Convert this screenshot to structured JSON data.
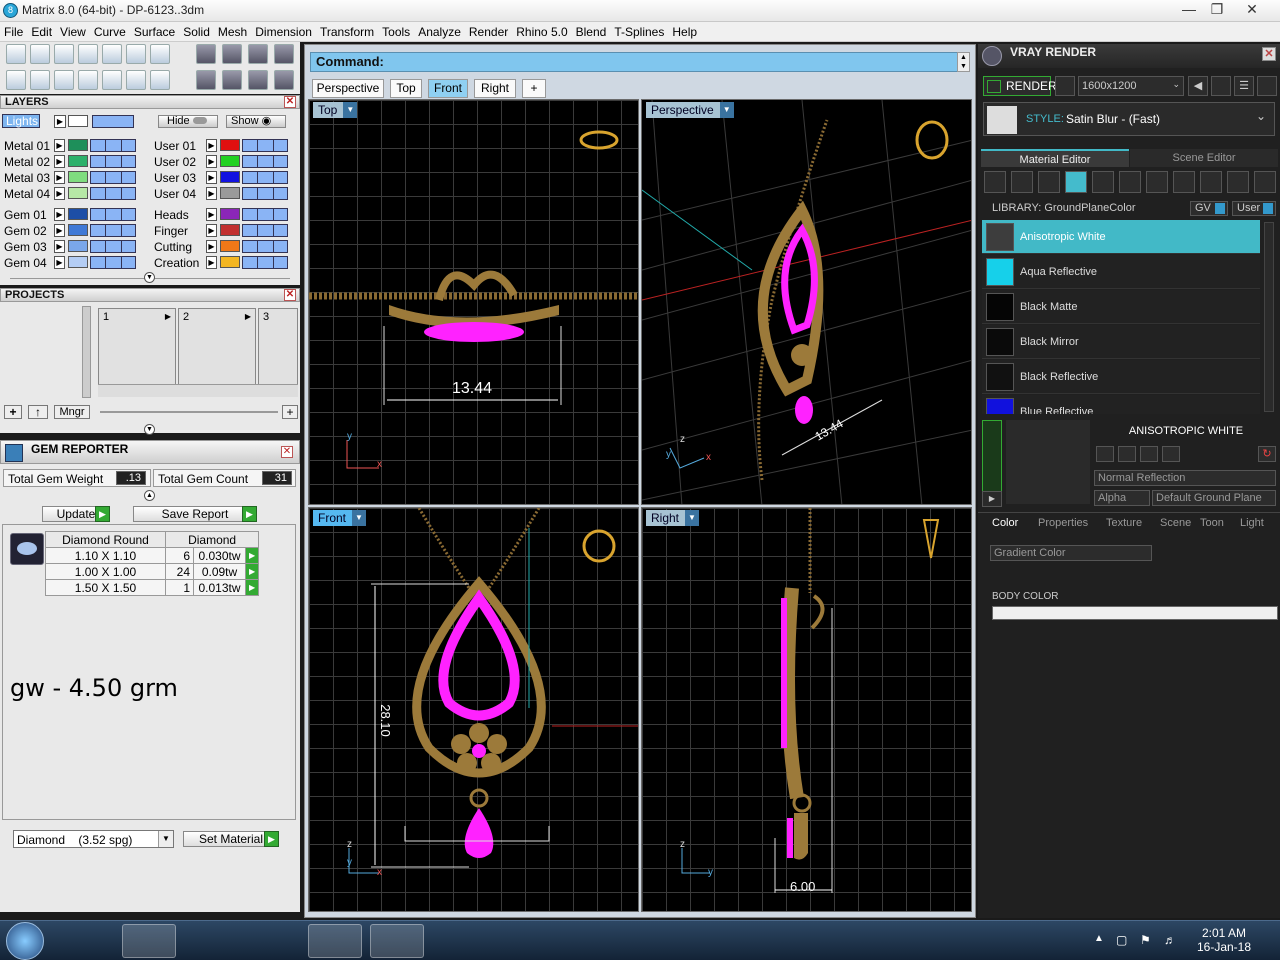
{
  "window": {
    "title": "Matrix 8.0 (64-bit) - DP-6123..3dm",
    "app_icon": "8"
  },
  "menu": [
    "File",
    "Edit",
    "View",
    "Curve",
    "Surface",
    "Solid",
    "Mesh",
    "Dimension",
    "Transform",
    "Tools",
    "Analyze",
    "Render",
    "Rhino 5.0",
    "Blend",
    "T-Splines",
    "Help"
  ],
  "layers": {
    "title": "LAYERS",
    "lights_label": "Lights",
    "hide_label": "Hide",
    "show_label": "Show",
    "left": [
      {
        "name": "Metal 01",
        "color": "#1e8f5a"
      },
      {
        "name": "Metal 02",
        "color": "#2bb06a"
      },
      {
        "name": "Metal 03",
        "color": "#7fdc7f"
      },
      {
        "name": "Metal 04",
        "color": "#b6e8a6"
      },
      {
        "name": "Gem 01",
        "color": "#1d4ea6"
      },
      {
        "name": "Gem 02",
        "color": "#3f79d6"
      },
      {
        "name": "Gem 03",
        "color": "#7aa7ea"
      },
      {
        "name": "Gem 04",
        "color": "#b4cdf4"
      }
    ],
    "right": [
      {
        "name": "User 01",
        "color": "#e01010"
      },
      {
        "name": "User 02",
        "color": "#22d122"
      },
      {
        "name": "User 03",
        "color": "#1212e0"
      },
      {
        "name": "User 04",
        "color": "#9a9a9a"
      },
      {
        "name": "Heads",
        "color": "#8b26b8"
      },
      {
        "name": "Finger",
        "color": "#c23030"
      },
      {
        "name": "Cutting",
        "color": "#f07818"
      },
      {
        "name": "Creation",
        "color": "#f4b622"
      }
    ]
  },
  "projects": {
    "title": "PROJECTS",
    "slots": [
      "1",
      "2",
      "3"
    ],
    "manager_label": "Mngr"
  },
  "gem_reporter": {
    "title": "GEM REPORTER",
    "weight_label": "Total Gem Weight",
    "weight_value": ".13",
    "count_label": "Total Gem Count",
    "count_value": "31",
    "update_label": "Update",
    "save_label": "Save Report",
    "table_header": [
      "Diamond Round",
      "Diamond"
    ],
    "rows": [
      {
        "size": "1.10 X 1.10",
        "count": "6",
        "weight": "0.030tw"
      },
      {
        "size": "1.00 X 1.00",
        "count": "24",
        "weight": "0.09tw"
      },
      {
        "size": "1.50 X 1.50",
        "count": "1",
        "weight": "0.013tw"
      }
    ],
    "note": "gw - 4.50 grm",
    "material_select": "Diamond    (3.52 spg)",
    "set_material_label": "Set Material"
  },
  "command": {
    "label": "Command:"
  },
  "view_tabs": [
    {
      "label": "Perspective",
      "active": false
    },
    {
      "label": "Top",
      "active": false
    },
    {
      "label": "Front",
      "active": true
    },
    {
      "label": "Right",
      "active": false
    },
    {
      "label": "+",
      "active": false
    }
  ],
  "viewports": {
    "top": {
      "label": "Top",
      "dimension": "13.44"
    },
    "perspective": {
      "label": "Perspective",
      "dimension": "13.44"
    },
    "front": {
      "label": "Front",
      "dimension": "28.10"
    },
    "right": {
      "label": "Right",
      "dimension": "6.00"
    }
  },
  "axes": {
    "x": "x",
    "y": "y",
    "z": "z"
  },
  "vray": {
    "title": "VRAY RENDER",
    "render_label": "RENDER",
    "resolution": "1600x1200",
    "style_label": "STYLE:",
    "style_value": "Satin Blur - (Fast)",
    "tabs": [
      "Material Editor",
      "Scene Editor"
    ],
    "library_label": "LIBRARY: GroundPlaneColor",
    "gv_label": "GV",
    "user_label": "User",
    "materials": [
      {
        "name": "Anisotropic White",
        "color": "#3d3d3d",
        "active": true
      },
      {
        "name": "Aqua Reflective",
        "color": "#16d0ea",
        "active": false
      },
      {
        "name": "Black Matte",
        "color": "#050505",
        "active": false
      },
      {
        "name": "Black Mirror",
        "color": "#0a0a0a",
        "active": false
      },
      {
        "name": "Black Reflective",
        "color": "#111111",
        "active": false
      },
      {
        "name": "Blue Reflective",
        "color": "#1111dd",
        "active": false
      }
    ],
    "selected_title": "ANISOTROPIC WHITE",
    "reflection": "Normal Reflection",
    "alpha_label": "Alpha",
    "ground_plane": "Default Ground Plane",
    "sub_tabs": [
      "Color",
      "Properties",
      "Texture",
      "Scene",
      "Toon",
      "Light"
    ],
    "color_type": "Gradient Color",
    "body_color_label": "BODY COLOR"
  },
  "taskbar": {
    "time": "2:01 AM",
    "date": "16-Jan-18"
  },
  "colors": {
    "gem": "#ff22ff",
    "metal": "#9c7a3a",
    "accent": "#42b9c7"
  }
}
